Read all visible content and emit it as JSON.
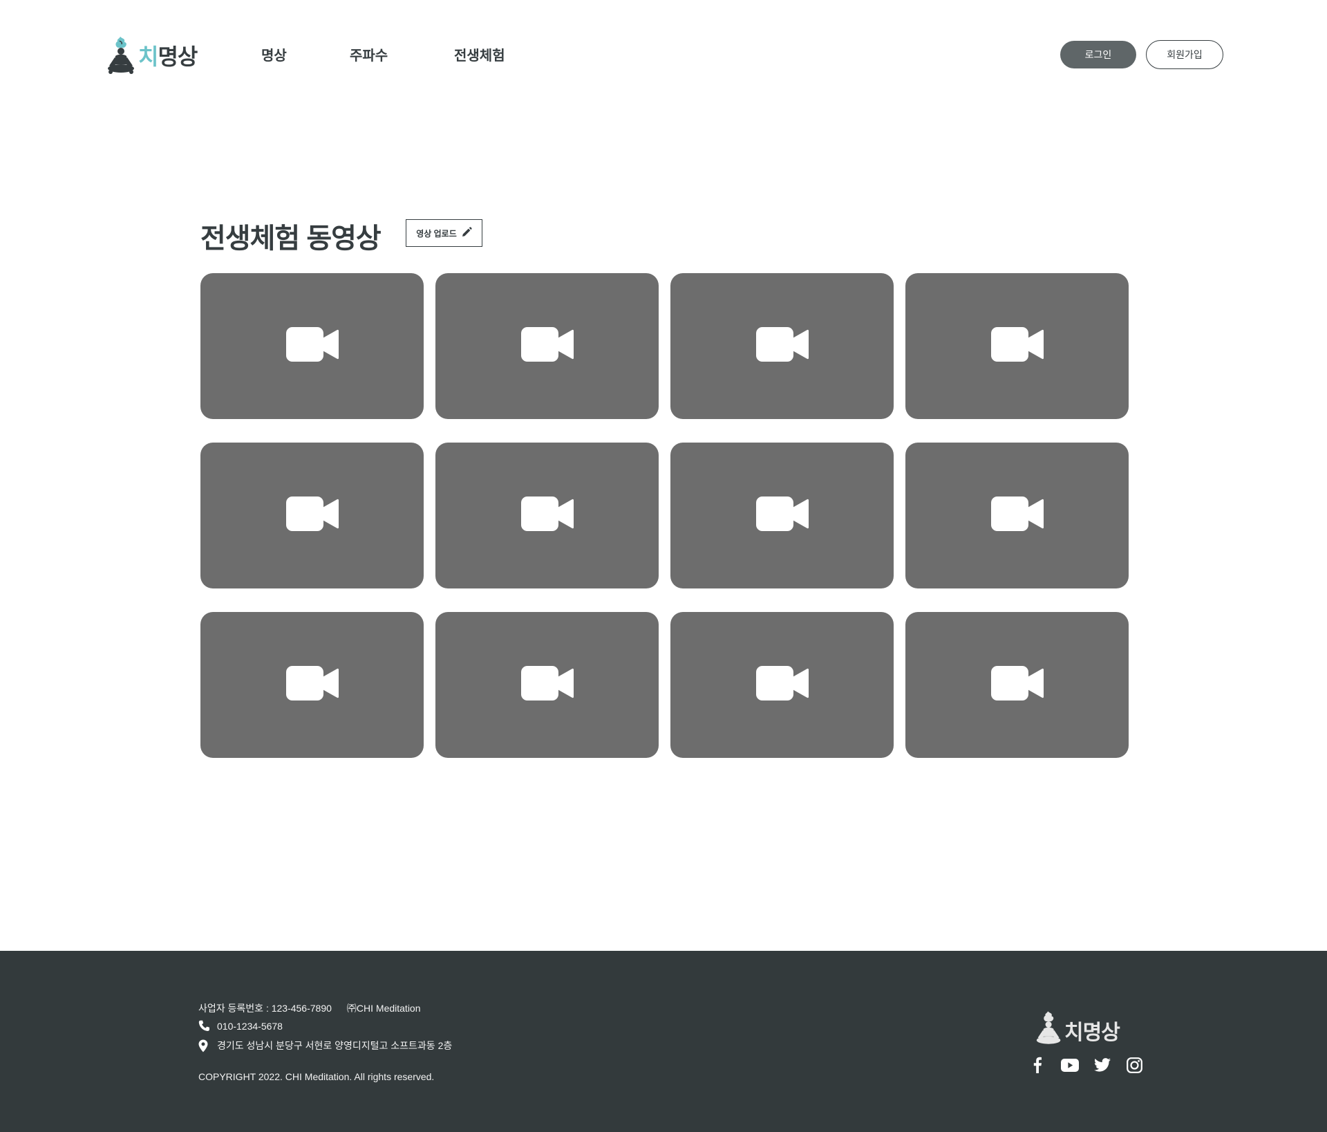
{
  "brand": {
    "logo_chi": "치",
    "logo_rest": "명상",
    "logo_icon": "meditation-figure-icon",
    "accent_color": "#6cc3c9",
    "dark_color": "#333a3c"
  },
  "nav": {
    "items": [
      {
        "label": "명상"
      },
      {
        "label": "주파수"
      },
      {
        "label": "전생체험"
      }
    ]
  },
  "auth": {
    "login_label": "로그인",
    "signup_label": "회원가입"
  },
  "main": {
    "title": "전생체험 동영상",
    "upload_label": "영상 업로드",
    "upload_icon": "pencil-icon",
    "video_icon": "video-camera-icon",
    "card_color": "#6d6d6d",
    "videos": [
      {
        "icon": "video-camera-icon"
      },
      {
        "icon": "video-camera-icon"
      },
      {
        "icon": "video-camera-icon"
      },
      {
        "icon": "video-camera-icon"
      },
      {
        "icon": "video-camera-icon"
      },
      {
        "icon": "video-camera-icon"
      },
      {
        "icon": "video-camera-icon"
      },
      {
        "icon": "video-camera-icon"
      },
      {
        "icon": "video-camera-icon"
      },
      {
        "icon": "video-camera-icon"
      },
      {
        "icon": "video-camera-icon"
      },
      {
        "icon": "video-camera-icon"
      }
    ]
  },
  "footer": {
    "business_number": "사업자 등록번호 : 123-456-7890",
    "company": "㈜CHI Meditation",
    "phone": "010-1234-5678",
    "address": "경기도 성남시 분당구 서현로 양영디지털고 소프트과동 2층",
    "copyright": "COPYRIGHT 2022. CHI Meditation. All rights reserved.",
    "socials": [
      "facebook-icon",
      "youtube-icon",
      "twitter-icon",
      "instagram-icon"
    ]
  }
}
